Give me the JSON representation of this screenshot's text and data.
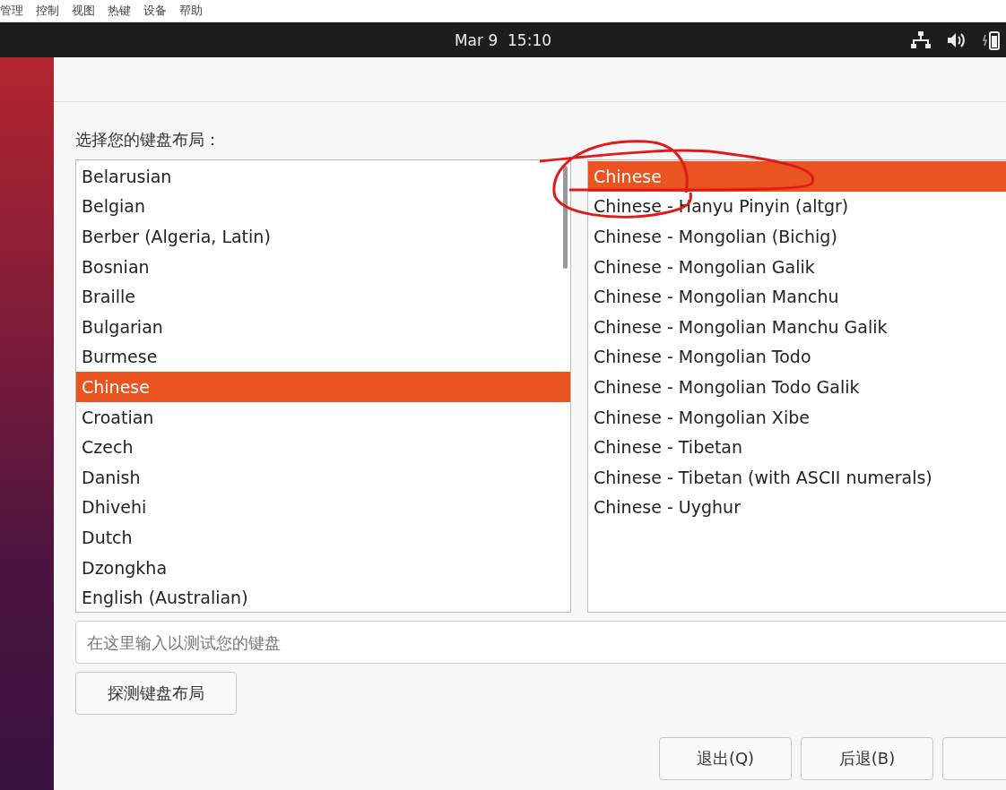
{
  "menu_bar": [
    "管理",
    "控制",
    "视图",
    "热键",
    "设备",
    "帮助"
  ],
  "top_bar": {
    "clock": "Mar 9  15:10"
  },
  "dialog": {
    "prompt": "选择您的键盘布局：",
    "layouts": [
      {
        "label": "Belarusian",
        "selected": false
      },
      {
        "label": "Belgian",
        "selected": false
      },
      {
        "label": "Berber (Algeria, Latin)",
        "selected": false
      },
      {
        "label": "Bosnian",
        "selected": false
      },
      {
        "label": "Braille",
        "selected": false
      },
      {
        "label": "Bulgarian",
        "selected": false
      },
      {
        "label": "Burmese",
        "selected": false
      },
      {
        "label": "Chinese",
        "selected": true
      },
      {
        "label": "Croatian",
        "selected": false
      },
      {
        "label": "Czech",
        "selected": false
      },
      {
        "label": "Danish",
        "selected": false
      },
      {
        "label": "Dhivehi",
        "selected": false
      },
      {
        "label": "Dutch",
        "selected": false
      },
      {
        "label": "Dzongkha",
        "selected": false
      },
      {
        "label": "English (Australian)",
        "selected": false
      }
    ],
    "variants": [
      {
        "label": "Chinese",
        "selected": true
      },
      {
        "label": "Chinese - Hanyu Pinyin (altgr)",
        "selected": false
      },
      {
        "label": "Chinese - Mongolian (Bichig)",
        "selected": false
      },
      {
        "label": "Chinese - Mongolian Galik",
        "selected": false
      },
      {
        "label": "Chinese - Mongolian Manchu",
        "selected": false
      },
      {
        "label": "Chinese - Mongolian Manchu Galik",
        "selected": false
      },
      {
        "label": "Chinese - Mongolian Todo",
        "selected": false
      },
      {
        "label": "Chinese - Mongolian Todo Galik",
        "selected": false
      },
      {
        "label": "Chinese - Mongolian Xibe",
        "selected": false
      },
      {
        "label": "Chinese - Tibetan",
        "selected": false
      },
      {
        "label": "Chinese - Tibetan (with ASCII numerals)",
        "selected": false
      },
      {
        "label": "Chinese - Uyghur",
        "selected": false
      }
    ],
    "test_field": {
      "placeholder": "在这里输入以测试您的键盘"
    },
    "detect_button": "探测键盘布局",
    "buttons": [
      "退出(Q)",
      "后退(B)"
    ]
  }
}
